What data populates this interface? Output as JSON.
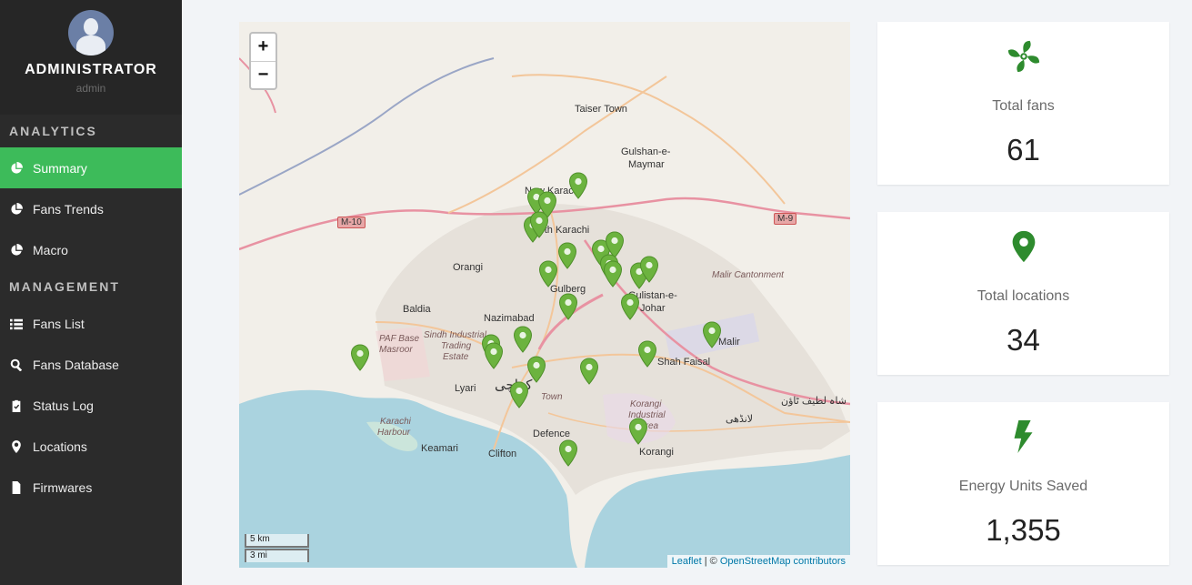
{
  "profile": {
    "name": "ADMINISTRATOR",
    "role": "admin"
  },
  "sidebar": {
    "analytics_title": "ANALYTICS",
    "analytics_items": [
      {
        "label": "Summary",
        "icon": "pie-chart-icon",
        "active": true
      },
      {
        "label": "Fans Trends",
        "icon": "pie-chart-icon",
        "active": false
      },
      {
        "label": "Macro",
        "icon": "pie-chart-icon",
        "active": false
      }
    ],
    "management_title": "MANAGEMENT",
    "management_items": [
      {
        "label": "Fans List",
        "icon": "list-icon"
      },
      {
        "label": "Fans Database",
        "icon": "search-icon"
      },
      {
        "label": "Status Log",
        "icon": "clipboard-check-icon"
      },
      {
        "label": "Locations",
        "icon": "map-marker-icon"
      },
      {
        "label": "Firmwares",
        "icon": "file-icon"
      }
    ]
  },
  "map": {
    "zoom_in": "+",
    "zoom_out": "−",
    "scale_km": "5 km",
    "scale_mi": "3 mi",
    "attribution_leaflet": "Leaflet",
    "attribution_sep": " | © ",
    "attribution_osm": "OpenStreetMap contributors",
    "labels": {
      "taiser_town": "Taiser Town",
      "gulshan_maymar_1": "Gulshan-e-",
      "gulshan_maymar_2": "Maymar",
      "new_karachi_1": "New Karachi",
      "new_karachi_2": "North Karachi",
      "orangi": "Orangi",
      "baldia": "Baldia",
      "nazimabad": "Nazimabad",
      "gulberg": "Gulberg",
      "johar_1": "Gulistan-e-",
      "johar_2": "Johar",
      "malir_cantonment": "Malir Cantonment",
      "malir": "Malir",
      "shah_faisal": "Shah Faisal",
      "sindh_industrial_1": "Sindh Industrial",
      "sindh_industrial_2": "Trading",
      "sindh_industrial_3": "Estate",
      "paf_base_1": "PAF Base",
      "paf_base_2": "Masroor",
      "lyari": "Lyari",
      "karachi_urdu": "کراچی",
      "jamshed_town": "Town",
      "karachi_harbour_1": "Karachi",
      "karachi_harbour_2": "Harbour",
      "keamari": "Keamari",
      "clifton": "Clifton",
      "defence": "Defence",
      "korangi_area_1": "Korangi",
      "korangi_area_2": "Industrial",
      "korangi_area_3": "Area",
      "korangi": "Korangi",
      "landhi_urdu": "لانڈھی",
      "shah_latif_urdu": "شاہ لطیف ٹاؤن",
      "m10": "M-10",
      "m9": "M-9"
    }
  },
  "cards": [
    {
      "label": "Total fans",
      "value": "61",
      "icon": "fan-icon",
      "color": "#2e8b2e"
    },
    {
      "label": "Total locations",
      "value": "34",
      "icon": "map-marker-icon",
      "color": "#2e8b2e"
    },
    {
      "label": "Energy Units Saved",
      "value": "1,355",
      "icon": "bolt-icon",
      "color": "#2e8b2e"
    }
  ],
  "colors": {
    "accent": "#3dbb5a",
    "marker": "#6cb33f",
    "sidebar": "#2b2b2b"
  }
}
